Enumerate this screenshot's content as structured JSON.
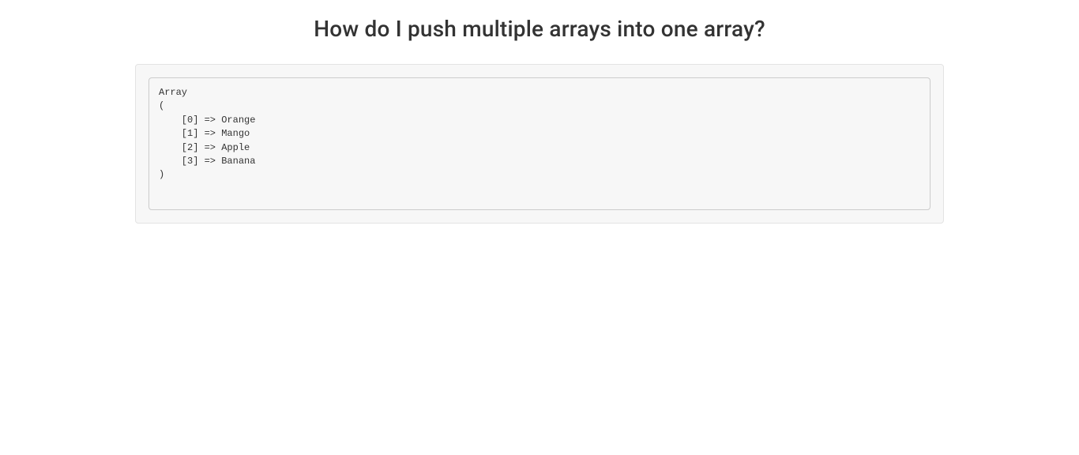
{
  "title": "How do I push multiple arrays into one array?",
  "code_output": "Array\n(\n    [0] => Orange\n    [1] => Mango\n    [2] => Apple\n    [3] => Banana\n)"
}
